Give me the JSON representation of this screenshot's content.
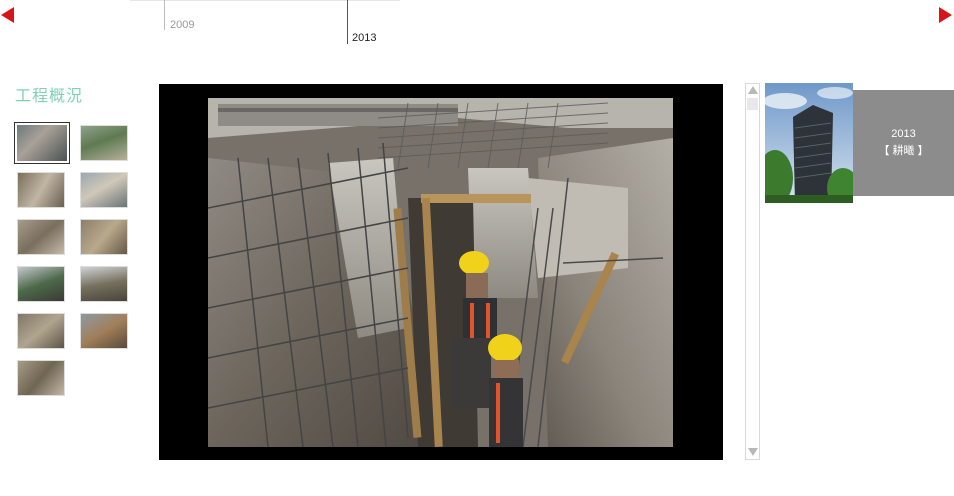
{
  "timeline": {
    "years": [
      {
        "label": "2009",
        "active": false
      },
      {
        "label": "2013",
        "active": true
      }
    ]
  },
  "section": {
    "title": "工程概況"
  },
  "thumbnails": {
    "count": 11,
    "selected_index": 0
  },
  "project_card": {
    "year": "2013",
    "name": "【 耕曦 】"
  },
  "colors": {
    "accent_red": "#d8141b",
    "title_green": "#7fd1b7",
    "card_gray": "#8c8c8c"
  }
}
